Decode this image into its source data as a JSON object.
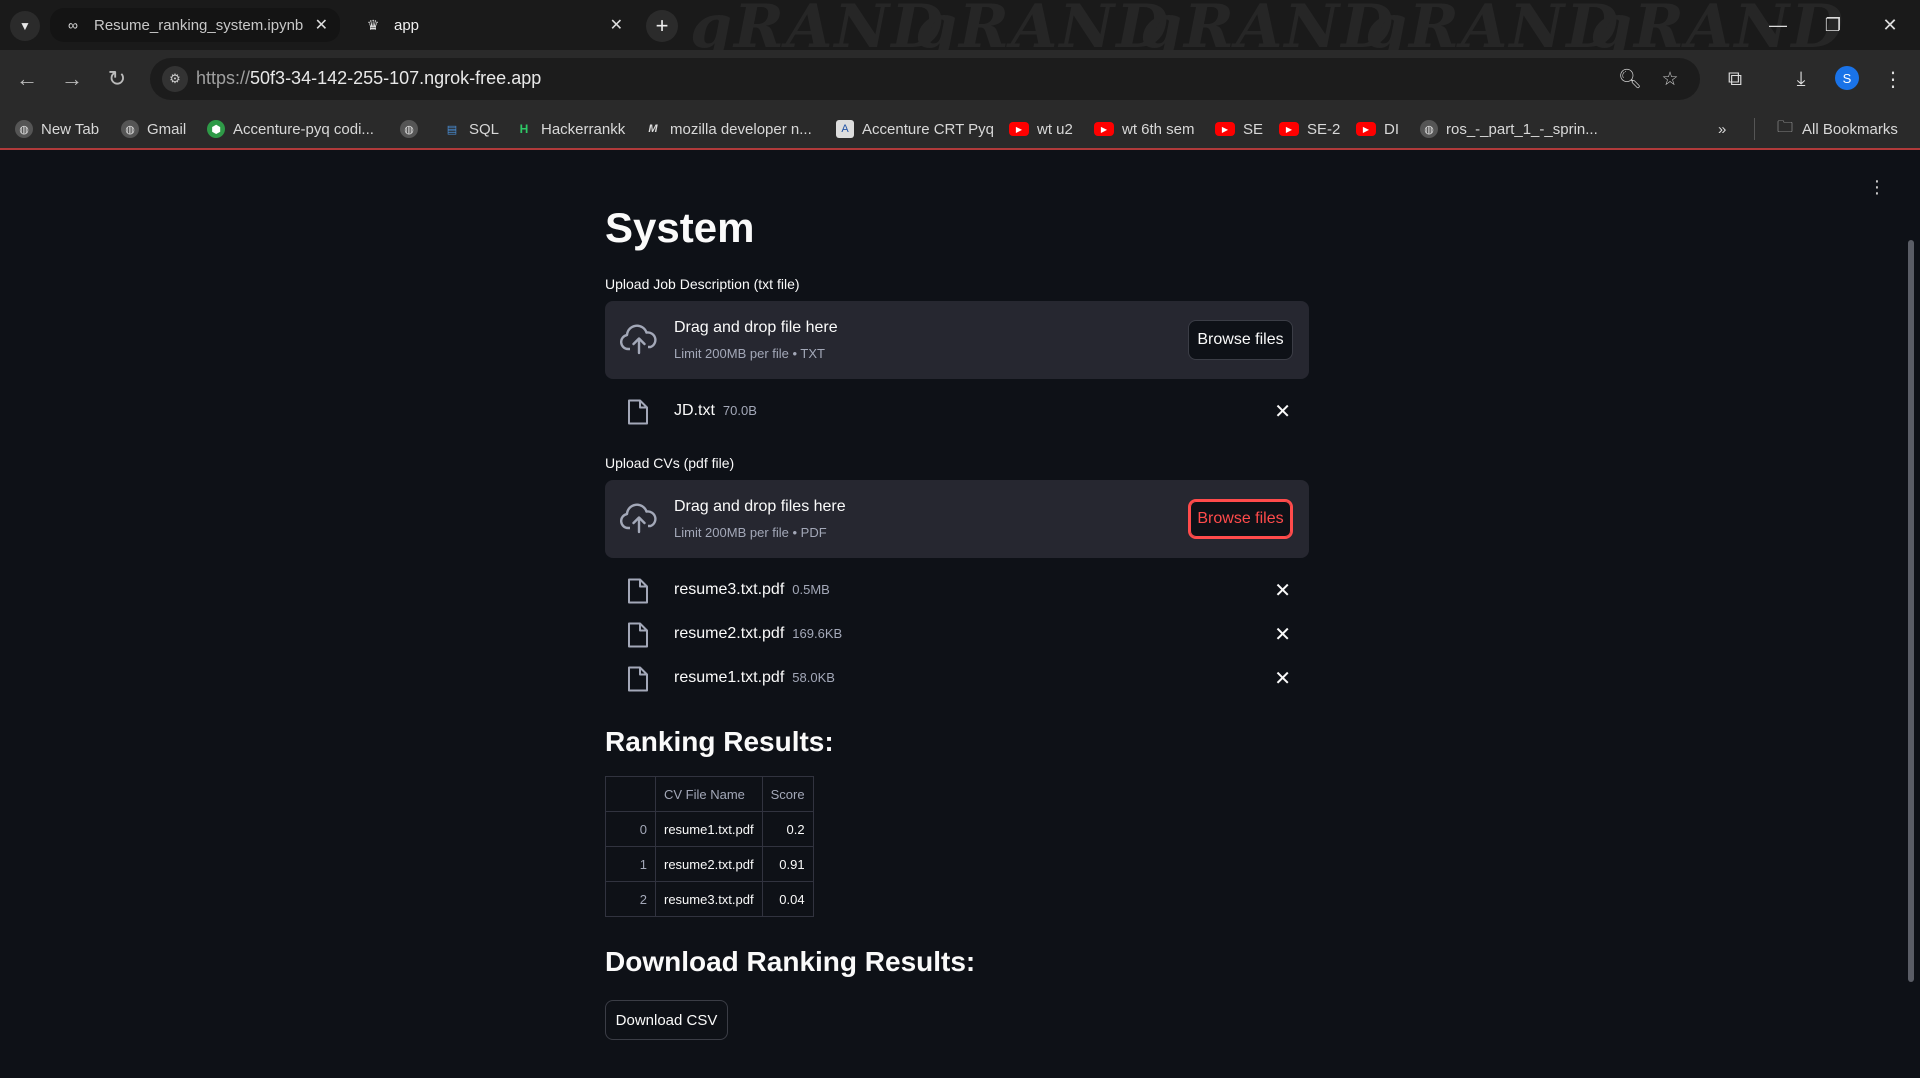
{
  "browser": {
    "tabs": [
      {
        "label": "Resume_ranking_system.ipynb",
        "icon": "colab-icon"
      },
      {
        "label": "app",
        "icon": "streamlit-icon"
      }
    ],
    "url_host": "50f3-34-142-255-107.ngrok-free.app",
    "url_scheme": "https://",
    "profile_initial": "S",
    "bookmarks": [
      {
        "label": "New Tab",
        "icon": "globe"
      },
      {
        "label": "Gmail",
        "icon": "globe"
      },
      {
        "label": "Accenture-pyq codi...",
        "icon": "green"
      },
      {
        "label": "",
        "icon": "globe"
      },
      {
        "label": "SQL",
        "icon": "sql"
      },
      {
        "label": "Hackerrankk",
        "icon": "hr"
      },
      {
        "label": "mozilla developer n...",
        "icon": "m"
      },
      {
        "label": "Accenture CRT Pyq",
        "icon": "acc"
      },
      {
        "label": "wt u2",
        "icon": "yt"
      },
      {
        "label": "wt 6th sem",
        "icon": "yt"
      },
      {
        "label": "SE",
        "icon": "yt"
      },
      {
        "label": "SE-2",
        "icon": "yt"
      },
      {
        "label": "DI",
        "icon": "yt"
      },
      {
        "label": "ros_-_part_1_-_sprin...",
        "icon": "globe"
      }
    ],
    "all_bookmarks": "All Bookmarks",
    "accent_color": "#1a73e8"
  },
  "app": {
    "title": "System",
    "jd_uploader": {
      "label": "Upload Job Description (txt file)",
      "drop_text": "Drag and drop file here",
      "limit_text": "Limit 200MB per file • TXT",
      "browse_label": "Browse files",
      "files": [
        {
          "name": "JD.txt",
          "size": "70.0B"
        }
      ]
    },
    "cv_uploader": {
      "label": "Upload CVs (pdf file)",
      "drop_text": "Drag and drop files here",
      "limit_text": "Limit 200MB per file • PDF",
      "browse_label": "Browse files",
      "files": [
        {
          "name": "resume3.txt.pdf",
          "size": "0.5MB"
        },
        {
          "name": "resume2.txt.pdf",
          "size": "169.6KB"
        },
        {
          "name": "resume1.txt.pdf",
          "size": "58.0KB"
        }
      ]
    },
    "ranking": {
      "heading": "Ranking Results:",
      "columns": [
        "",
        "CV File Name",
        "Score"
      ],
      "rows": [
        {
          "index": "0",
          "file": "resume1.txt.pdf",
          "score": "0.2"
        },
        {
          "index": "1",
          "file": "resume2.txt.pdf",
          "score": "0.91"
        },
        {
          "index": "2",
          "file": "resume3.txt.pdf",
          "score": "0.04"
        }
      ]
    },
    "download": {
      "heading": "Download Ranking Results:",
      "button_label": "Download CSV"
    },
    "colors": {
      "background": "#0e1117",
      "secondary_bg": "#262730",
      "primary": "#ff4b4b"
    }
  }
}
